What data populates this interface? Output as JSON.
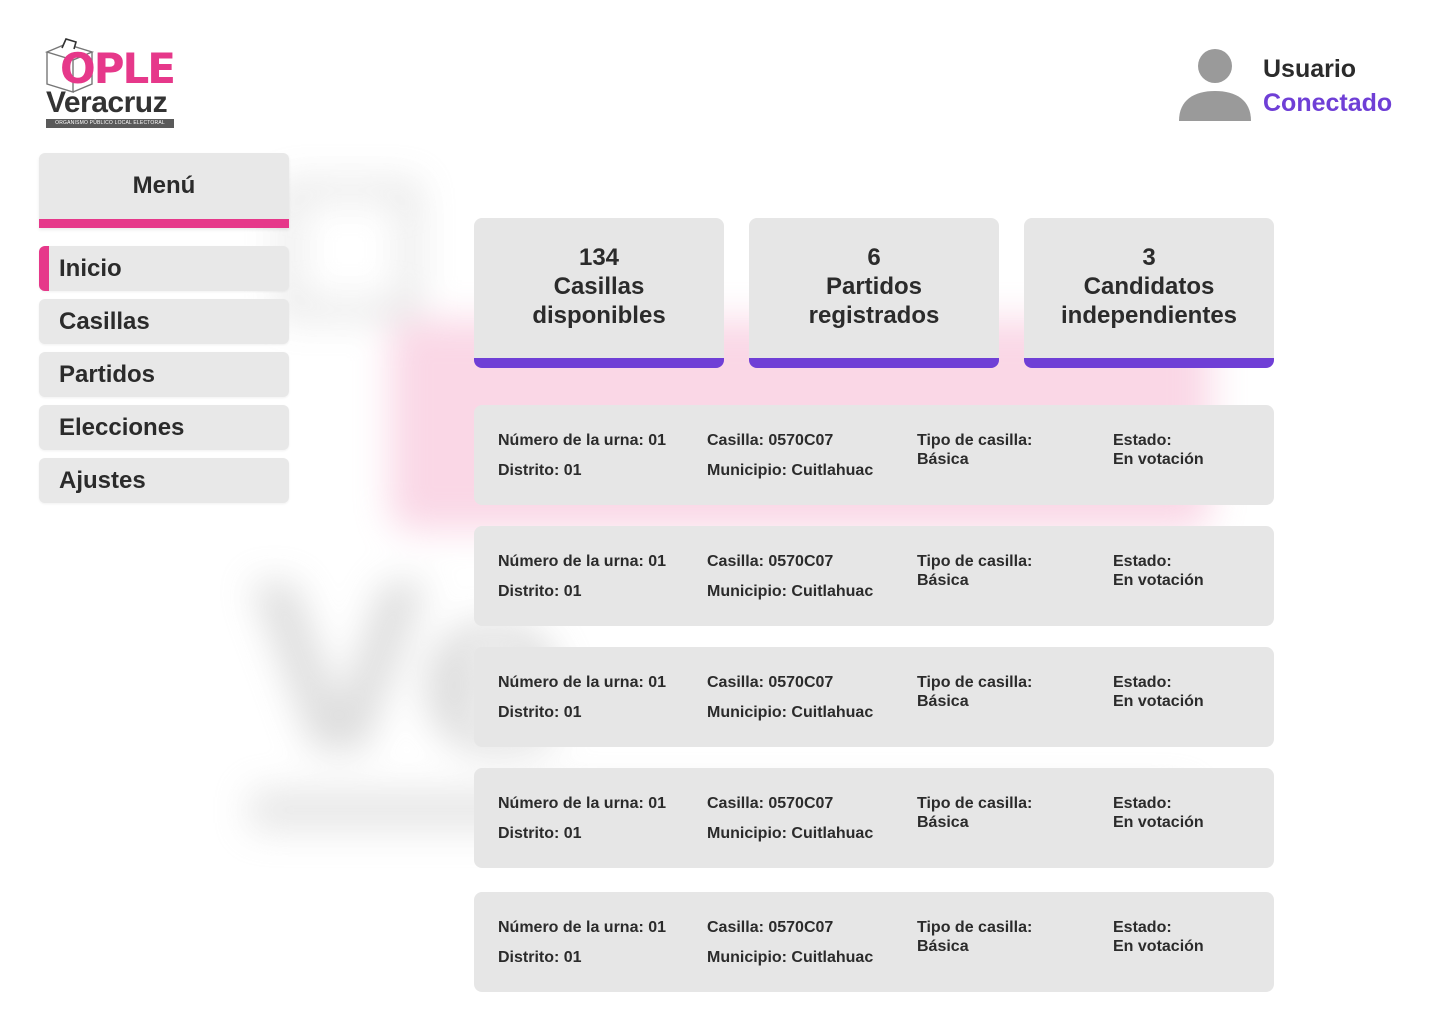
{
  "logo": {
    "brand": "OPLE",
    "region": "Veracruz",
    "tagline": "ORGANISMO PÚBLICO LOCAL ELECTORAL"
  },
  "user": {
    "name": "Usuario",
    "status": "Conectado",
    "icon": "user-avatar-icon"
  },
  "menu": {
    "title": "Menú",
    "items": [
      {
        "label": "Inicio",
        "active": true
      },
      {
        "label": "Casillas",
        "active": false
      },
      {
        "label": "Partidos",
        "active": false
      },
      {
        "label": "Elecciones",
        "active": false
      },
      {
        "label": "Ajustes",
        "active": false
      }
    ]
  },
  "stats": [
    {
      "value": "134",
      "line1": "Casillas",
      "line2": "disponibles"
    },
    {
      "value": "6",
      "line1": "Partidos",
      "line2": "registrados"
    },
    {
      "value": "3",
      "line1": "Candidatos",
      "line2": "independientes"
    }
  ],
  "records": [
    {
      "urna": "Número de la urna: 01",
      "distrito": "Distrito: 01",
      "casilla": "Casilla: 0570C07",
      "municipio": "Municipio: Cuitlahuac",
      "tipo_label": "Tipo de casilla:",
      "tipo": "Básica",
      "estado_label": "Estado:",
      "estado": "En votación"
    },
    {
      "urna": "Número de la urna: 01",
      "distrito": "Distrito: 01",
      "casilla": "Casilla: 0570C07",
      "municipio": "Municipio: Cuitlahuac",
      "tipo_label": "Tipo de casilla:",
      "tipo": "Básica",
      "estado_label": "Estado:",
      "estado": "En votación"
    },
    {
      "urna": "Número de la urna: 01",
      "distrito": "Distrito: 01",
      "casilla": "Casilla: 0570C07",
      "municipio": "Municipio: Cuitlahuac",
      "tipo_label": "Tipo de casilla:",
      "tipo": "Básica",
      "estado_label": "Estado:",
      "estado": "En votación"
    },
    {
      "urna": "Número de la urna: 01",
      "distrito": "Distrito: 01",
      "casilla": "Casilla: 0570C07",
      "municipio": "Municipio: Cuitlahuac",
      "tipo_label": "Tipo de casilla:",
      "tipo": "Básica",
      "estado_label": "Estado:",
      "estado": "En votación"
    },
    {
      "urna": "Número de la urna: 01",
      "distrito": "Distrito: 01",
      "casilla": "Casilla: 0570C07",
      "municipio": "Municipio: Cuitlahuac",
      "tipo_label": "Tipo de casilla:",
      "tipo": "Básica",
      "estado_label": "Estado:",
      "estado": "En votación"
    }
  ],
  "colors": {
    "brand_pink": "#e6388a",
    "accent_purple": "#6f3fd6",
    "card_gray": "#e6e6e6"
  }
}
